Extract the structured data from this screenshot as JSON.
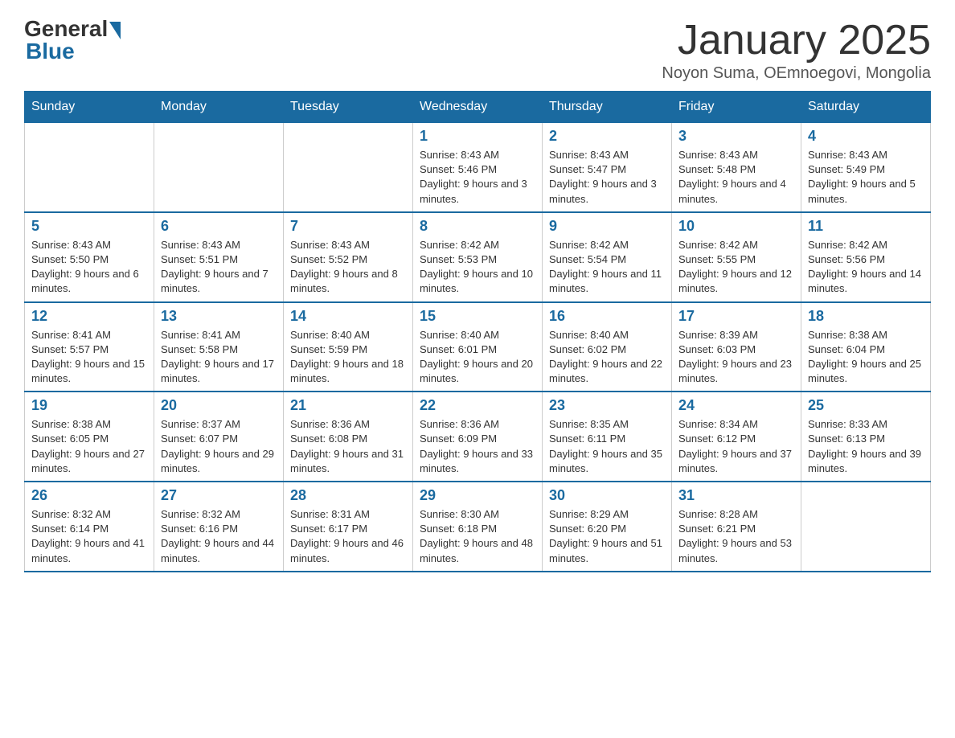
{
  "header": {
    "logo_general": "General",
    "logo_blue": "Blue",
    "month_title": "January 2025",
    "subtitle": "Noyon Suma, OEmnoegovi, Mongolia"
  },
  "days_of_week": [
    "Sunday",
    "Monday",
    "Tuesday",
    "Wednesday",
    "Thursday",
    "Friday",
    "Saturday"
  ],
  "weeks": [
    [
      {
        "day": "",
        "info": ""
      },
      {
        "day": "",
        "info": ""
      },
      {
        "day": "",
        "info": ""
      },
      {
        "day": "1",
        "info": "Sunrise: 8:43 AM\nSunset: 5:46 PM\nDaylight: 9 hours and 3 minutes."
      },
      {
        "day": "2",
        "info": "Sunrise: 8:43 AM\nSunset: 5:47 PM\nDaylight: 9 hours and 3 minutes."
      },
      {
        "day": "3",
        "info": "Sunrise: 8:43 AM\nSunset: 5:48 PM\nDaylight: 9 hours and 4 minutes."
      },
      {
        "day": "4",
        "info": "Sunrise: 8:43 AM\nSunset: 5:49 PM\nDaylight: 9 hours and 5 minutes."
      }
    ],
    [
      {
        "day": "5",
        "info": "Sunrise: 8:43 AM\nSunset: 5:50 PM\nDaylight: 9 hours and 6 minutes."
      },
      {
        "day": "6",
        "info": "Sunrise: 8:43 AM\nSunset: 5:51 PM\nDaylight: 9 hours and 7 minutes."
      },
      {
        "day": "7",
        "info": "Sunrise: 8:43 AM\nSunset: 5:52 PM\nDaylight: 9 hours and 8 minutes."
      },
      {
        "day": "8",
        "info": "Sunrise: 8:42 AM\nSunset: 5:53 PM\nDaylight: 9 hours and 10 minutes."
      },
      {
        "day": "9",
        "info": "Sunrise: 8:42 AM\nSunset: 5:54 PM\nDaylight: 9 hours and 11 minutes."
      },
      {
        "day": "10",
        "info": "Sunrise: 8:42 AM\nSunset: 5:55 PM\nDaylight: 9 hours and 12 minutes."
      },
      {
        "day": "11",
        "info": "Sunrise: 8:42 AM\nSunset: 5:56 PM\nDaylight: 9 hours and 14 minutes."
      }
    ],
    [
      {
        "day": "12",
        "info": "Sunrise: 8:41 AM\nSunset: 5:57 PM\nDaylight: 9 hours and 15 minutes."
      },
      {
        "day": "13",
        "info": "Sunrise: 8:41 AM\nSunset: 5:58 PM\nDaylight: 9 hours and 17 minutes."
      },
      {
        "day": "14",
        "info": "Sunrise: 8:40 AM\nSunset: 5:59 PM\nDaylight: 9 hours and 18 minutes."
      },
      {
        "day": "15",
        "info": "Sunrise: 8:40 AM\nSunset: 6:01 PM\nDaylight: 9 hours and 20 minutes."
      },
      {
        "day": "16",
        "info": "Sunrise: 8:40 AM\nSunset: 6:02 PM\nDaylight: 9 hours and 22 minutes."
      },
      {
        "day": "17",
        "info": "Sunrise: 8:39 AM\nSunset: 6:03 PM\nDaylight: 9 hours and 23 minutes."
      },
      {
        "day": "18",
        "info": "Sunrise: 8:38 AM\nSunset: 6:04 PM\nDaylight: 9 hours and 25 minutes."
      }
    ],
    [
      {
        "day": "19",
        "info": "Sunrise: 8:38 AM\nSunset: 6:05 PM\nDaylight: 9 hours and 27 minutes."
      },
      {
        "day": "20",
        "info": "Sunrise: 8:37 AM\nSunset: 6:07 PM\nDaylight: 9 hours and 29 minutes."
      },
      {
        "day": "21",
        "info": "Sunrise: 8:36 AM\nSunset: 6:08 PM\nDaylight: 9 hours and 31 minutes."
      },
      {
        "day": "22",
        "info": "Sunrise: 8:36 AM\nSunset: 6:09 PM\nDaylight: 9 hours and 33 minutes."
      },
      {
        "day": "23",
        "info": "Sunrise: 8:35 AM\nSunset: 6:11 PM\nDaylight: 9 hours and 35 minutes."
      },
      {
        "day": "24",
        "info": "Sunrise: 8:34 AM\nSunset: 6:12 PM\nDaylight: 9 hours and 37 minutes."
      },
      {
        "day": "25",
        "info": "Sunrise: 8:33 AM\nSunset: 6:13 PM\nDaylight: 9 hours and 39 minutes."
      }
    ],
    [
      {
        "day": "26",
        "info": "Sunrise: 8:32 AM\nSunset: 6:14 PM\nDaylight: 9 hours and 41 minutes."
      },
      {
        "day": "27",
        "info": "Sunrise: 8:32 AM\nSunset: 6:16 PM\nDaylight: 9 hours and 44 minutes."
      },
      {
        "day": "28",
        "info": "Sunrise: 8:31 AM\nSunset: 6:17 PM\nDaylight: 9 hours and 46 minutes."
      },
      {
        "day": "29",
        "info": "Sunrise: 8:30 AM\nSunset: 6:18 PM\nDaylight: 9 hours and 48 minutes."
      },
      {
        "day": "30",
        "info": "Sunrise: 8:29 AM\nSunset: 6:20 PM\nDaylight: 9 hours and 51 minutes."
      },
      {
        "day": "31",
        "info": "Sunrise: 8:28 AM\nSunset: 6:21 PM\nDaylight: 9 hours and 53 minutes."
      },
      {
        "day": "",
        "info": ""
      }
    ]
  ]
}
